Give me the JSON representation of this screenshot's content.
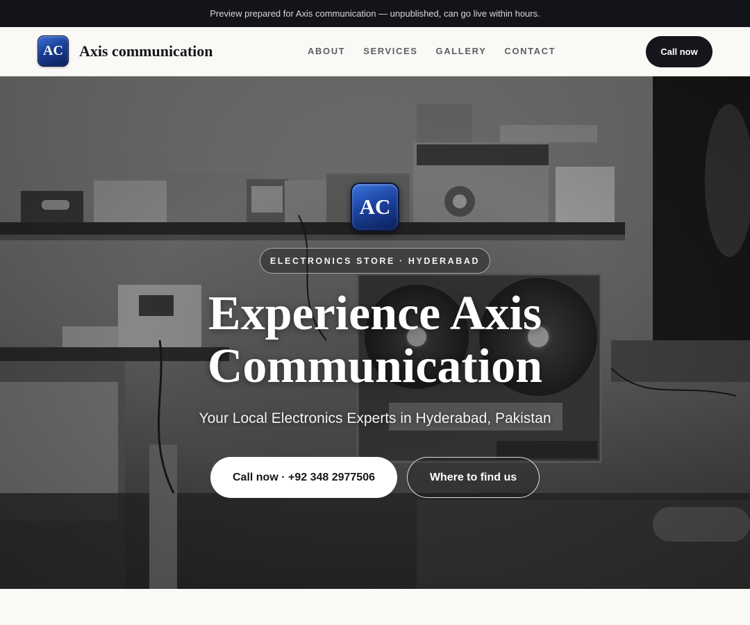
{
  "banner": {
    "text": "Preview prepared for Axis communication — unpublished, can go live within hours."
  },
  "header": {
    "logo_text": "AC",
    "brand_name": "Axis communication",
    "nav": [
      "ABOUT",
      "SERVICES",
      "GALLERY",
      "CONTACT"
    ],
    "call_label": "Call now"
  },
  "hero": {
    "logo_text": "AC",
    "tag": "ELECTRONICS STORE · HYDERABAD",
    "title_line1": "Experience Axis",
    "title_line2": "Communication",
    "subtitle": "Your Local Electronics Experts in Hyderabad, Pakistan",
    "primary_button": "Call now · +92 348 2977506",
    "secondary_button": "Where to find us"
  },
  "colors": {
    "banner_bg": "#12141a",
    "logo_blue": "#1c44a0",
    "dark_button": "#15161c",
    "page_bg": "#faf9f6"
  },
  "icons": {
    "hero_photo": "electronics-workshop-photo"
  }
}
